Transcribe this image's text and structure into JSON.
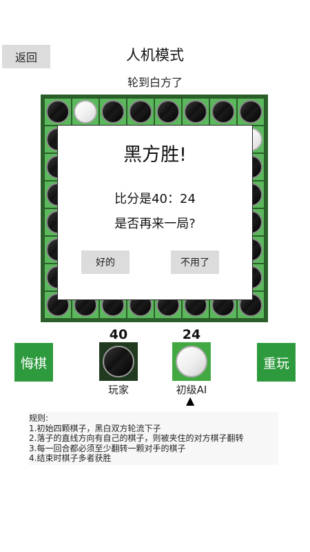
{
  "header": {
    "back_label": "返回",
    "title": "人机模式",
    "turn_text": "轮到白方了"
  },
  "board": {
    "size": 8,
    "visible_rows": {
      "row0": [
        "black",
        "white",
        "black",
        "black",
        "black",
        "black",
        "black",
        "black"
      ],
      "row7": [
        "black",
        "black",
        "black",
        "black",
        "black",
        "black",
        "black",
        "black"
      ]
    }
  },
  "modal": {
    "title": "黑方胜!",
    "score_text": "比分是40：24",
    "ask_text": "是否再来一局?",
    "yes_label": "好的",
    "no_label": "不用了"
  },
  "controls": {
    "undo_label": "悔棋",
    "restart_label": "重玩"
  },
  "players": {
    "black": {
      "count": "40",
      "label": "玩家"
    },
    "white": {
      "count": "24",
      "label": "初级AI",
      "indicator": "▲"
    }
  },
  "rules": {
    "heading": "规则:",
    "items": [
      "1.初始四颗棋子，黑白双方轮流下子",
      "2.落子的直线方向有自己的棋子，则被夹住的对方棋子翻转",
      "3.每一回合都必须至少翻转一颗对手的棋子",
      "4.结束时棋子多者获胜"
    ]
  },
  "colors": {
    "board_border": "#2a5f2a",
    "cell": "#5cb85c",
    "button_green": "#2e9a3e",
    "button_gray": "#dcdcdc"
  }
}
